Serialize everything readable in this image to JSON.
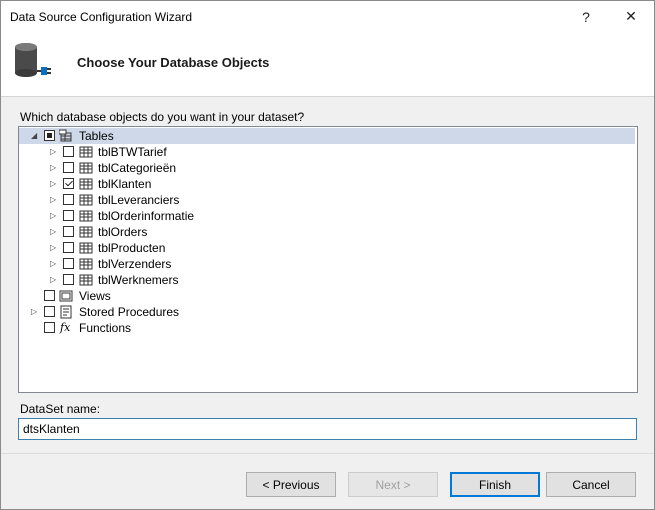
{
  "window": {
    "title": "Data Source Configuration Wizard",
    "help_label": "?",
    "close_label": "✕"
  },
  "header": {
    "heading": "Choose Your Database Objects"
  },
  "tree": {
    "question": "Which database objects do you want in your dataset?",
    "root": {
      "label": "Tables",
      "expanded": true,
      "check_state": "partial"
    },
    "tables": [
      {
        "label": "tblBTWTarief",
        "checked": false
      },
      {
        "label": "tblCategorieën",
        "checked": false
      },
      {
        "label": "tblKlanten",
        "checked": true
      },
      {
        "label": "tblLeveranciers",
        "checked": false
      },
      {
        "label": "tblOrderinformatie",
        "checked": false
      },
      {
        "label": "tblOrders",
        "checked": false
      },
      {
        "label": "tblProducten",
        "checked": false
      },
      {
        "label": "tblVerzenders",
        "checked": false
      },
      {
        "label": "tblWerknemers",
        "checked": false
      }
    ],
    "views": {
      "label": "Views",
      "checked": false
    },
    "stored_procedures": {
      "label": "Stored Procedures",
      "checked": false
    },
    "functions": {
      "label": "Functions",
      "checked": false,
      "icon_glyph": "fx"
    }
  },
  "dataset": {
    "label": "DataSet name:",
    "value": "dtsKlanten"
  },
  "buttons": {
    "previous": "< Previous",
    "next": "Next >",
    "finish": "Finish",
    "cancel": "Cancel"
  },
  "colors": {
    "selection": "#cfd8e8",
    "accent": "#0078d7"
  },
  "icons": {
    "header": "database-plug-icon",
    "table": "table-icon",
    "view": "view-icon",
    "procedure": "stored-procedure-icon",
    "function": "function-icon"
  }
}
